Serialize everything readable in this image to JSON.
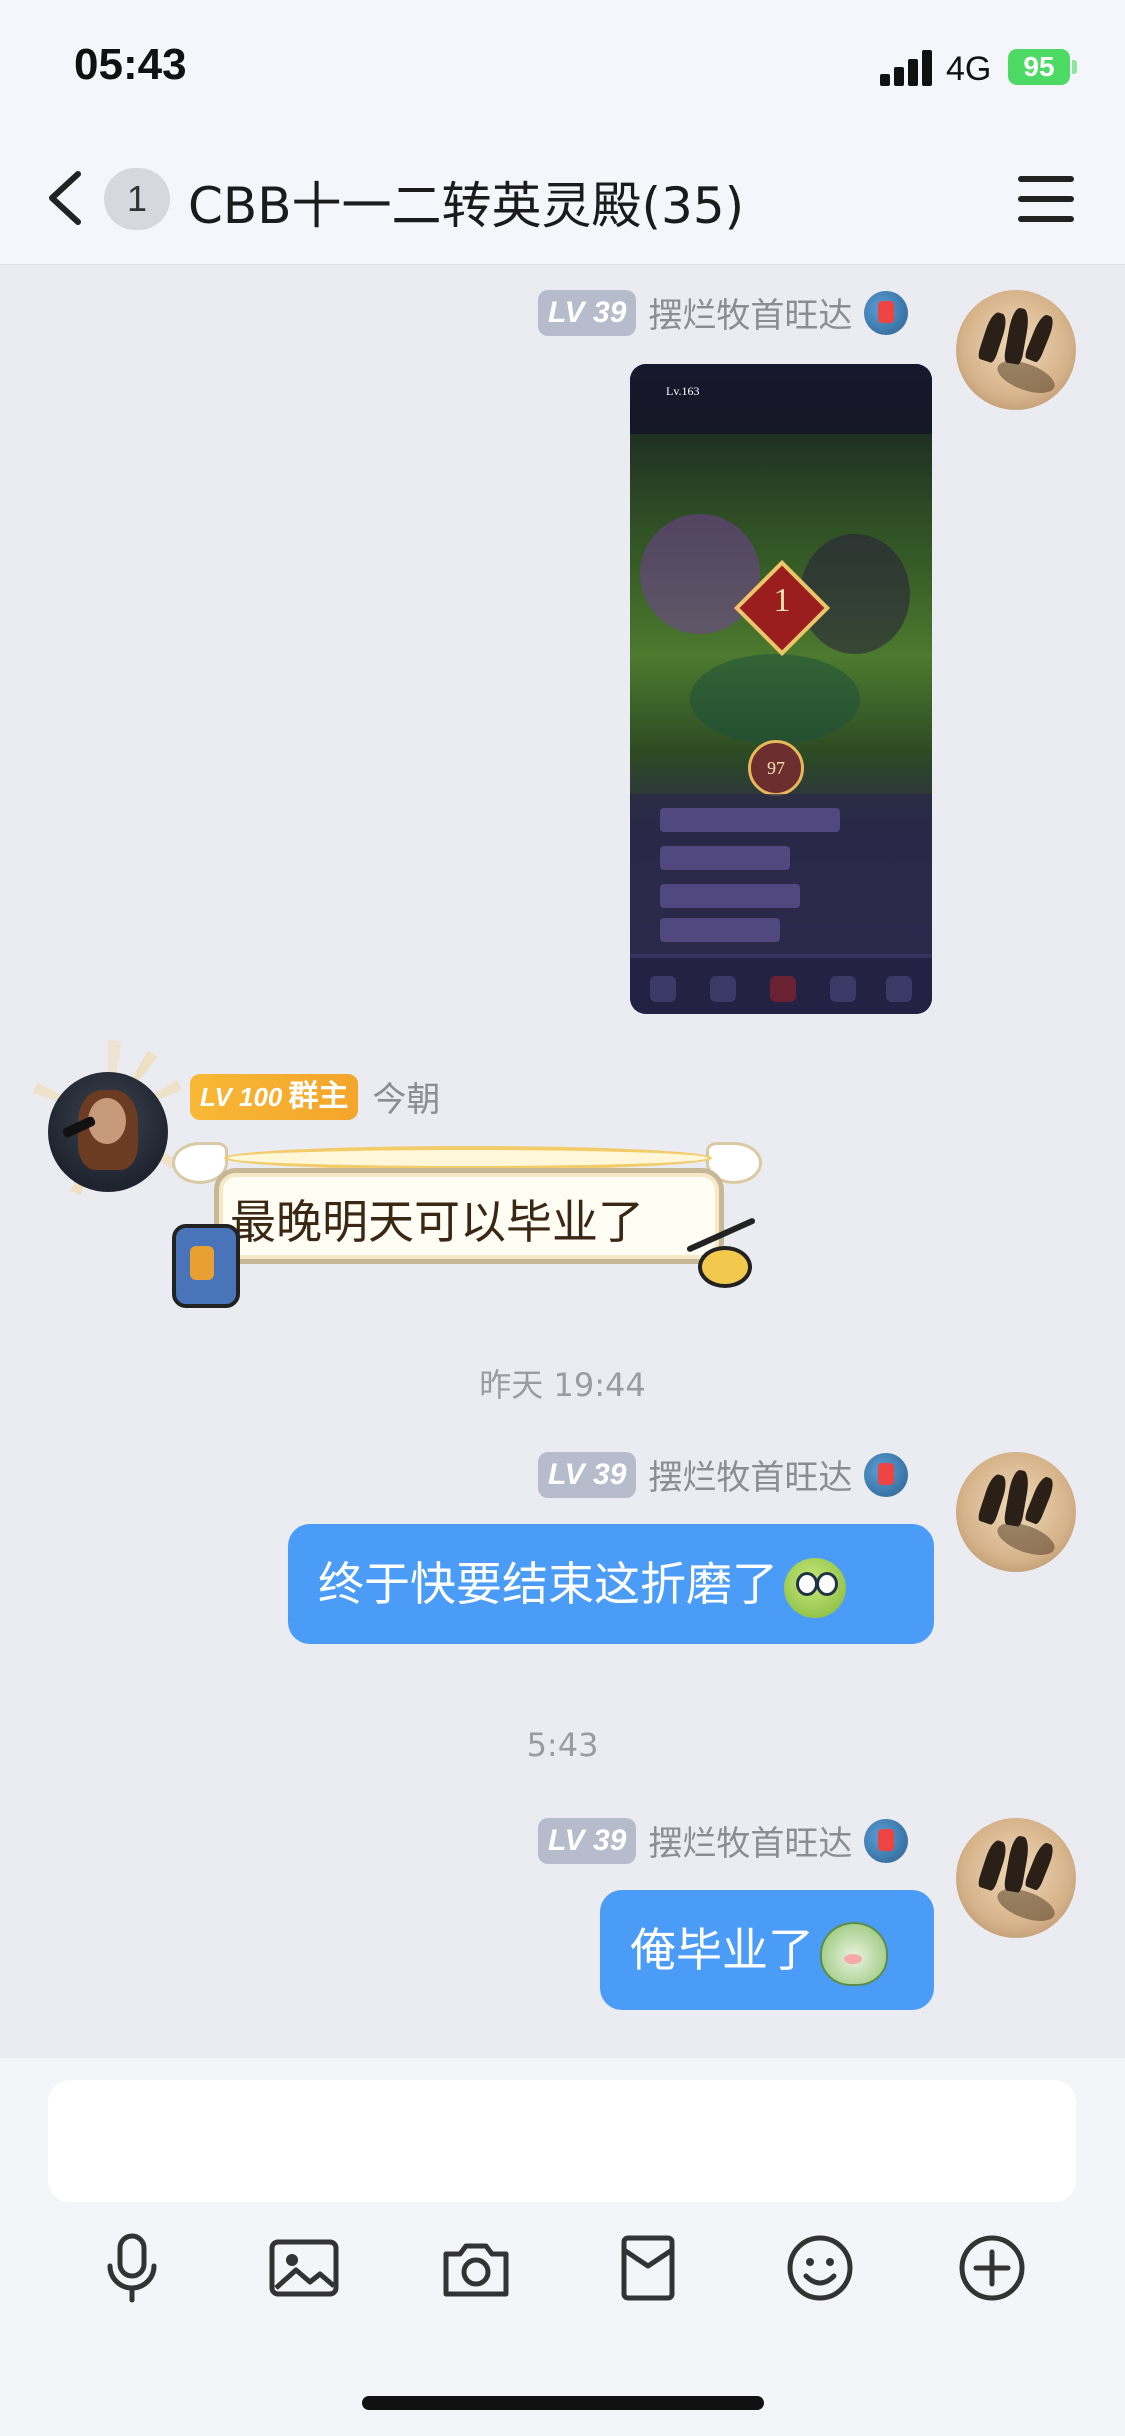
{
  "status_bar": {
    "time": "05:43",
    "network": "4G",
    "battery": "95"
  },
  "nav": {
    "unread_count": "1",
    "title": "CBB十一二转英灵殿(35)"
  },
  "messages": [
    {
      "side": "right",
      "level": "LV 39",
      "sender": "摆烂牧首旺达",
      "type": "image"
    },
    {
      "side": "left",
      "level": "LV 100",
      "role": "群主",
      "sender": "今朝",
      "type": "text",
      "text": "最晚明天可以毕业了"
    },
    {
      "side": "right",
      "level": "LV 39",
      "sender": "摆烂牧首旺达",
      "type": "text",
      "text": "终于快要结束这折磨了"
    },
    {
      "side": "right",
      "level": "LV 39",
      "sender": "摆烂牧首旺达",
      "type": "text",
      "text": "俺毕业了"
    }
  ],
  "timestamps": [
    "昨天 19:44",
    "5:43"
  ],
  "screenshot_thumb": {
    "level_text": "Lv.163",
    "stage_number": "1",
    "count": "97"
  },
  "toolbar_icons": [
    "microphone-icon",
    "image-icon",
    "camera-icon",
    "red-packet-icon",
    "emoji-icon",
    "plus-icon"
  ]
}
